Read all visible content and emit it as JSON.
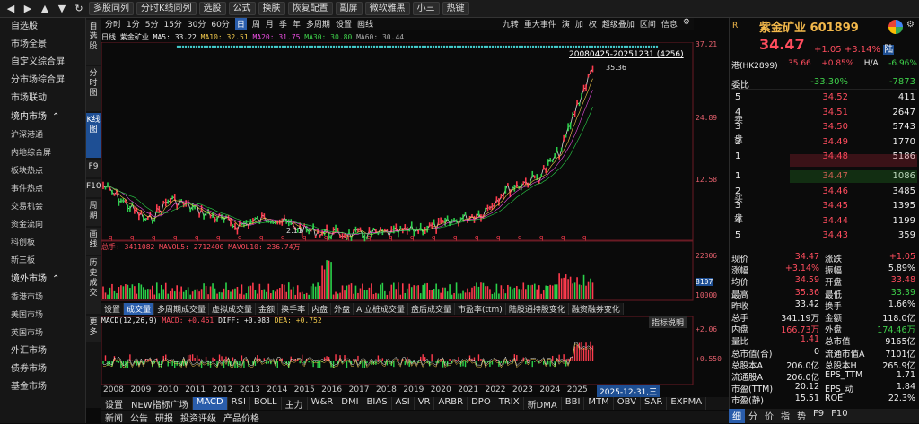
{
  "toolbar": {
    "nav_icons": [
      "◀",
      "▶",
      "▲",
      "▼",
      "↻"
    ],
    "buttons": [
      "多股同列",
      "分时K线同列",
      "选股",
      "公式",
      "换肤",
      "恢复配置",
      "副屏",
      "微软雅黑",
      "小三",
      "热键"
    ]
  },
  "sidebar": {
    "items": [
      "自选股",
      "市场全景",
      "自定义综合屏",
      "分市场综合屏",
      "市场联动"
    ],
    "domestic": {
      "header": "境内市场",
      "items": [
        "沪深港通",
        "内地综合屏",
        "板块热点",
        "事件热点",
        "交易机会",
        "资金流向",
        "科创板",
        "新三板"
      ]
    },
    "overseas": {
      "header": "境外市场",
      "items": [
        "香港市场",
        "美国市场",
        "英国市场"
      ]
    },
    "forex": "外汇市场",
    "bond": "债券市场",
    "fund": "基金市场"
  },
  "vstrip": {
    "items": [
      "自选股",
      "分时图",
      "K线图",
      "F9",
      "F10",
      "周期",
      "画线",
      "历史成交",
      "更多"
    ]
  },
  "period_tabs": {
    "items": [
      "分时",
      "1分",
      "5分",
      "15分",
      "30分",
      "60分",
      "日",
      "周",
      "月",
      "季",
      "年",
      "多周期",
      "设置",
      "画线"
    ],
    "active_index": 6,
    "right": [
      "九转",
      "重大事件",
      "演",
      "加",
      "权",
      "超级叠加",
      "区间",
      "信息",
      "⚙"
    ]
  },
  "ma_line": {
    "label": "日线 紫金矿业",
    "ma5": "MA5: 33.22",
    "ma10": "MA10: 32.51",
    "ma20": "MA20: 31.75",
    "ma30": "MA30: 30.80",
    "ma60": "MA60: 30.44"
  },
  "date_range": "20080425-20251231 (4256)",
  "price_axis": {
    "top": "37.21",
    "mid": "24.89",
    "low": "12.58"
  },
  "annotations": {
    "high": "35.36",
    "low": "2.11"
  },
  "volume": {
    "label": "总手: 3411082 MAVOL5: 2712400 MAVOL10: 236.74万",
    "axis": [
      "22306",
      "8107",
      "10000"
    ]
  },
  "indicator_tabs": {
    "items": [
      "设置",
      "成交量",
      "多周期成交量",
      "虚拟成交量",
      "金额",
      "换手率",
      "内盘",
      "外盘",
      "AI立桩成交量",
      "盘后成交量",
      "市盈率(ttm)",
      "陆股通持股变化",
      "融资融券变化"
    ],
    "active_index": 1
  },
  "macd": {
    "label": "MACD(12,26,9)",
    "macd": "MACD: +0.461",
    "diff": "DIFF: +0.983",
    "dea": "DEA: +0.752",
    "axis_top": "+2.06",
    "axis_mid": "+0.550",
    "explain": "指标说明"
  },
  "years": [
    "2008",
    "2009",
    "2010",
    "2011",
    "2012",
    "2013",
    "2014",
    "2015",
    "2016",
    "2017",
    "2018",
    "2019",
    "2020",
    "2021",
    "2022",
    "2023",
    "2024",
    "2025"
  ],
  "date_cursor": "2025-12-31,三",
  "indicator_bar": {
    "items": [
      "设置",
      "NEW指标广场",
      "MACD",
      "RSI",
      "BOLL",
      "主力",
      "W&R",
      "DMI",
      "BIAS",
      "ASI",
      "VR",
      "ARBR",
      "DPO",
      "TRIX",
      "新DMA",
      "BBI",
      "MTM",
      "OBV",
      "SAR",
      "EXPMA"
    ],
    "active_index": 2
  },
  "bottom_tabs": {
    "items": [
      "新闻",
      "公告",
      "研报",
      "投资评级",
      "产品价格"
    ]
  },
  "quote": {
    "name": "紫金矿业",
    "code": "601899",
    "price": "34.47",
    "change": "+1.05",
    "pct": "+3.14%",
    "tag": "陆",
    "hk": {
      "label": "港(HK2899)",
      "price": "35.66",
      "pct": "+0.85%",
      "ha_label": "H/A",
      "ha": "-6.96%"
    },
    "webi": {
      "label": "委比",
      "value": "-33.30%",
      "diff": "-7873"
    },
    "asks": [
      {
        "n": "5",
        "p": "34.52",
        "v": "411"
      },
      {
        "n": "4",
        "p": "34.51",
        "v": "2647"
      },
      {
        "n": "3",
        "p": "34.50",
        "v": "5743"
      },
      {
        "n": "2",
        "p": "34.49",
        "v": "1770"
      },
      {
        "n": "1",
        "p": "34.48",
        "v": "5186"
      }
    ],
    "bids": [
      {
        "n": "1",
        "p": "34.47",
        "v": "1086"
      },
      {
        "n": "2",
        "p": "34.46",
        "v": "3485"
      },
      {
        "n": "3",
        "p": "34.45",
        "v": "1395"
      },
      {
        "n": "4",
        "p": "34.44",
        "v": "1199"
      },
      {
        "n": "5",
        "p": "34.43",
        "v": "359"
      }
    ],
    "ask_side": "卖盘",
    "bid_side": "买盘",
    "stats": [
      [
        "现价",
        "34.47",
        "涨跌",
        "+1.05"
      ],
      [
        "涨幅",
        "+3.14%",
        "振幅",
        "5.89%"
      ],
      [
        "均价",
        "34.59",
        "开盘",
        "33.48"
      ],
      [
        "最高",
        "35.36",
        "最低",
        "33.39"
      ],
      [
        "昨收",
        "33.42",
        "换手",
        "1.66%"
      ],
      [
        "总手",
        "341.19万",
        "金额",
        "118.0亿"
      ],
      [
        "内盘",
        "166.73万",
        "外盘",
        "174.46万"
      ],
      [
        "量比",
        "1.41",
        "总市值",
        "9165亿"
      ],
      [
        "总市值(合)",
        "0",
        "流通市值A",
        "7101亿"
      ],
      [
        "总股本A",
        "206.0亿",
        "总股本H",
        "265.9亿"
      ],
      [
        "流通股A",
        "206.0亿",
        "EPS_TTM",
        "1.71"
      ],
      [
        "市盈(TTM)",
        "20.12",
        "EPS_动",
        "1.84"
      ],
      [
        "市盈(静)",
        "15.51",
        "ROE",
        "22.3%"
      ]
    ]
  },
  "right_footer": {
    "items": [
      "细",
      "分",
      "价",
      "指",
      "势",
      "F9",
      "F10"
    ],
    "active_index": 0
  }
}
